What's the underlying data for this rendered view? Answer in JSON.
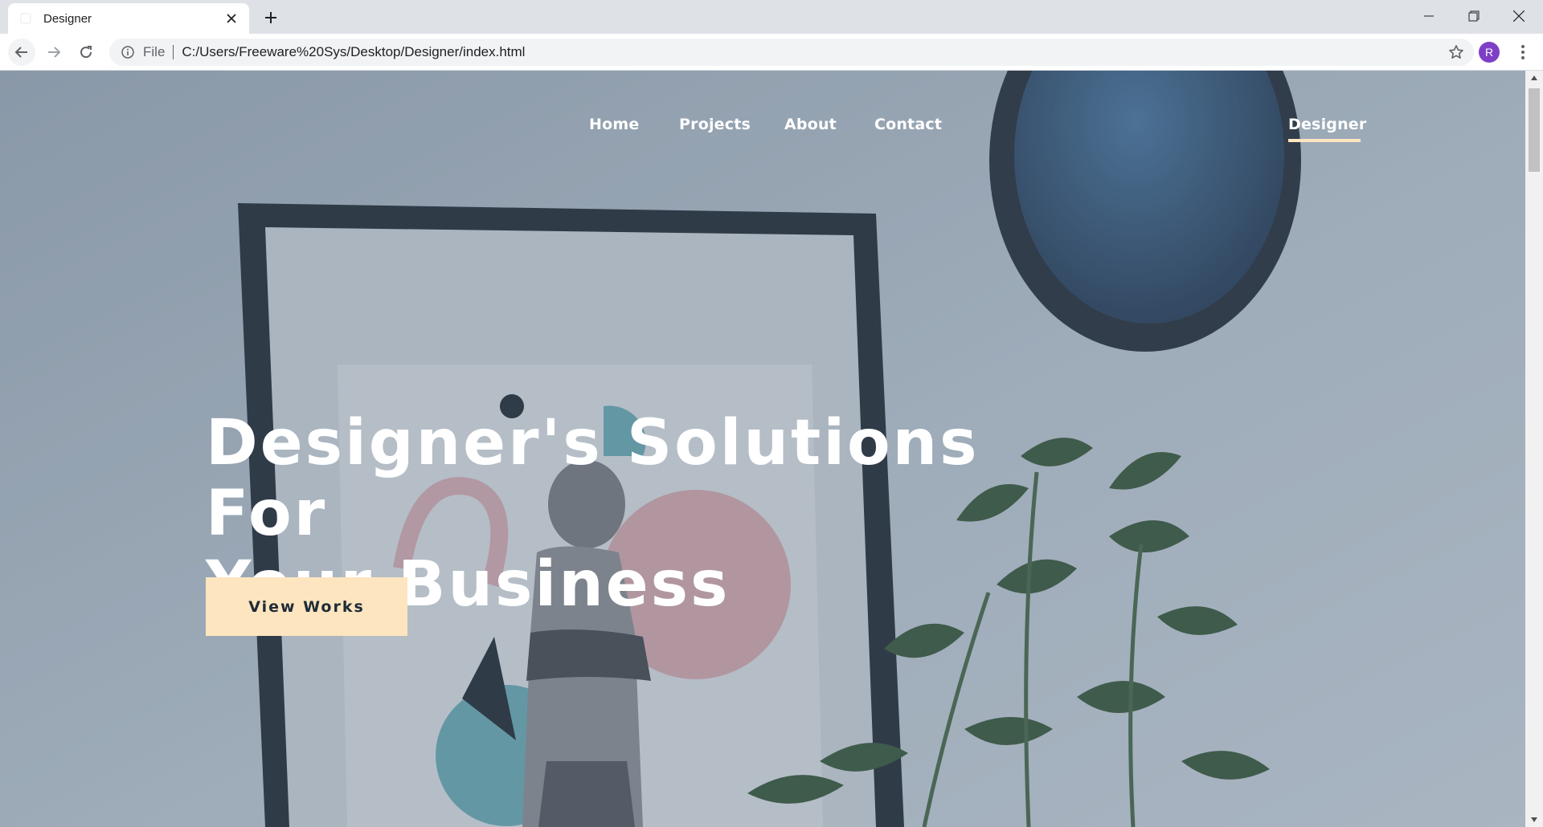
{
  "browser": {
    "tab": {
      "title": "Designer",
      "close_icon": "close-icon"
    },
    "new_tab_icon": "plus-icon",
    "window_controls": [
      "minimize-icon",
      "restore-icon",
      "close-icon"
    ],
    "address": {
      "scheme": "File",
      "url": "C:/Users/Freeware%20Sys/Desktop/Designer/index.html"
    },
    "profile_initial": "R",
    "accent_color": "#7e3fc6"
  },
  "site": {
    "nav": {
      "home": "Home",
      "projects": "Projects",
      "about": "About",
      "contact": "Contact",
      "brand": "Designer"
    },
    "hero": {
      "title_line1": "Designer's Solutions For",
      "title_line2": "Your Business",
      "cta": "View Works"
    },
    "colors": {
      "cta_bg": "#fde5c0",
      "cta_text": "#1f2b36"
    }
  }
}
